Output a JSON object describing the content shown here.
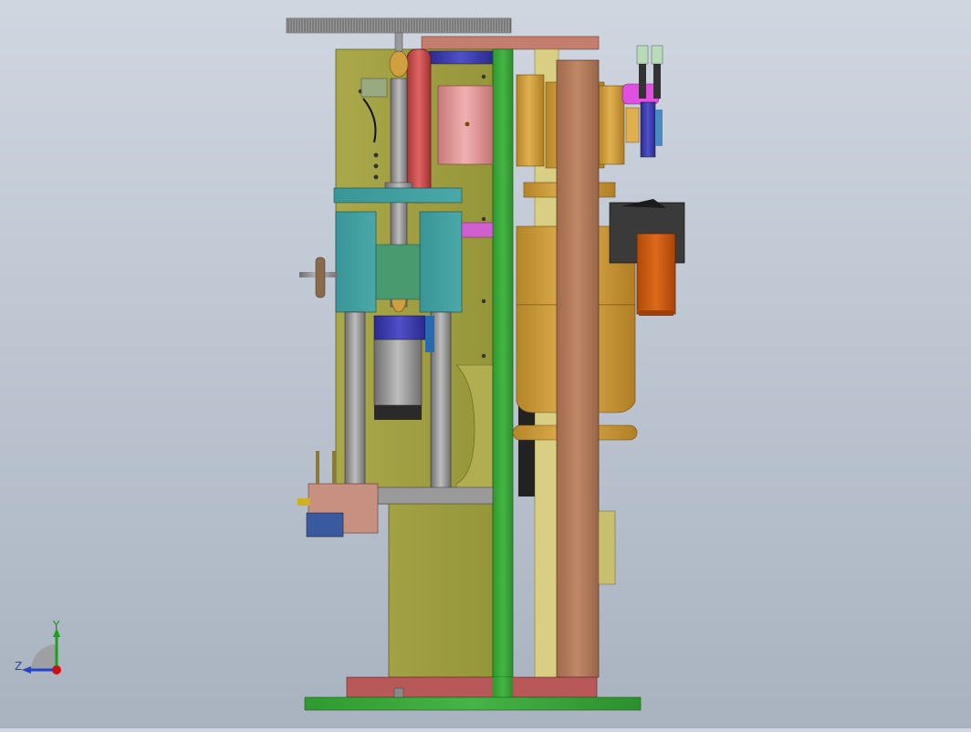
{
  "viewport": {
    "background_top": "#cfd6e0",
    "background_bottom": "#a9b3c0"
  },
  "triad": {
    "y_label": "Y",
    "z_label": "Z",
    "y_color": "#1aa31a",
    "z_color": "#2244cc",
    "x_color": "#cc1111"
  },
  "colors": {
    "olive_plate": "#a3a343",
    "green_plate": "#3aa83a",
    "copper_column": "#b07a5a",
    "gold_motor": "#c89a3a",
    "teal_block": "#3a9a9a",
    "salmon_roller": "#e0a0a0",
    "red_wheel": "#c84848",
    "steel_rod": "#8a8a8a",
    "blue_cylinder": "#3a3aaa",
    "orange_box": "#c85a10",
    "magenta_part": "#e050e0",
    "pink_block": "#c08070",
    "base_green": "#3aa83a",
    "base_red": "#b05050"
  }
}
